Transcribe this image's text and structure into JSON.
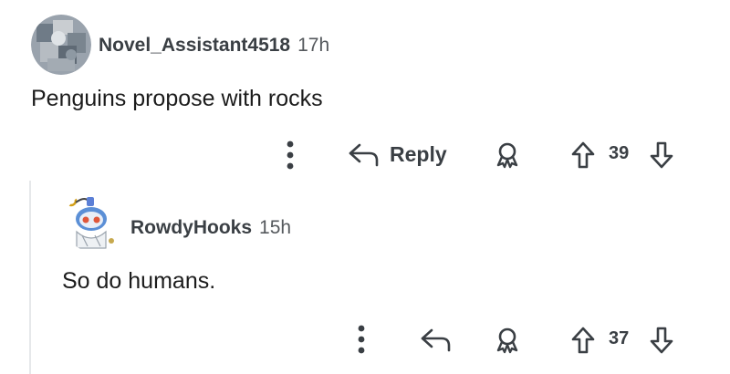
{
  "comments": [
    {
      "username": "Novel_Assistant4518",
      "time": "17h",
      "body": "Penguins propose with rocks",
      "reply_label": "Reply",
      "vote_count": "39"
    },
    {
      "username": "RowdyHooks",
      "time": "15h",
      "body": "So do humans.",
      "vote_count": "37"
    }
  ],
  "icons": {
    "more": "more-vertical-icon",
    "reply": "reply-arrow-icon",
    "award": "award-icon",
    "upvote": "upvote-arrow-icon",
    "downvote": "downvote-arrow-icon"
  }
}
